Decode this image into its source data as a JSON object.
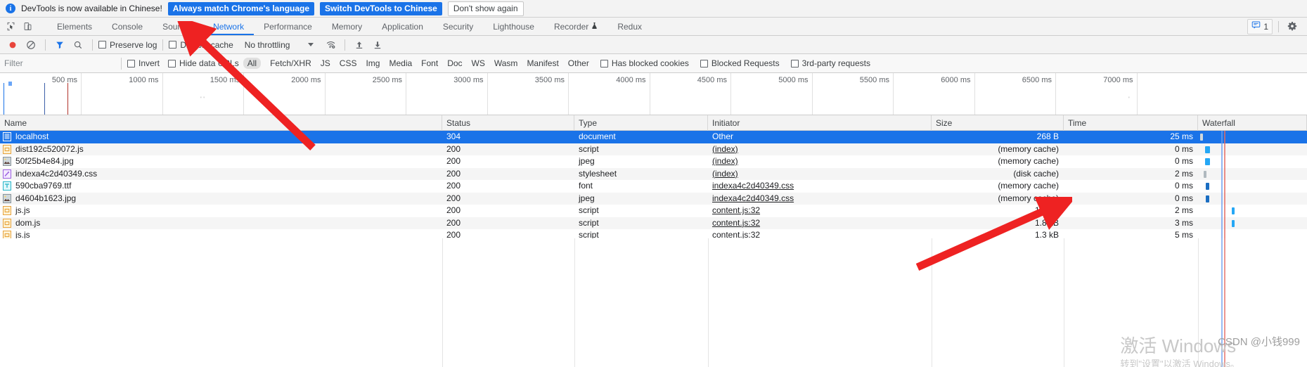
{
  "infobar": {
    "icon": "info-icon",
    "message": "DevTools is now available in Chinese!",
    "always_match_label": "Always match Chrome's language",
    "switch_label": "Switch DevTools to Chinese",
    "dismiss_label": "Don't show again"
  },
  "tabs": {
    "items": [
      {
        "label": "Elements",
        "active": false
      },
      {
        "label": "Console",
        "active": false
      },
      {
        "label": "Sources",
        "active": false
      },
      {
        "label": "Network",
        "active": true
      },
      {
        "label": "Performance",
        "active": false
      },
      {
        "label": "Memory",
        "active": false
      },
      {
        "label": "Application",
        "active": false
      },
      {
        "label": "Security",
        "active": false
      },
      {
        "label": "Lighthouse",
        "active": false
      },
      {
        "label": "Recorder",
        "active": false
      },
      {
        "label": "Redux",
        "active": false
      }
    ],
    "issues_count": "1",
    "inspect_icon": "inspect-cursor-icon",
    "device_icon": "device-toolbar-icon",
    "settings_icon": "gear-icon",
    "recorder_icon": "flask-icon",
    "issues_icon": "issues-message-icon"
  },
  "toolbar": {
    "record_icon": "record-stop-icon",
    "clear_icon": "clear-no-entry-icon",
    "filter_icon": "funnel-filter-icon",
    "search_icon": "search-magnifier-icon",
    "preserve_log_label": "Preserve log",
    "preserve_log_checked": false,
    "disable_cache_label": "Disable cache",
    "disable_cache_checked": false,
    "throttling_label": "No throttling",
    "wifi_icon": "network-conditions-wifi-icon",
    "import_icon": "import-har-up-arrow-icon",
    "export_icon": "export-har-down-arrow-icon"
  },
  "filterbar": {
    "placeholder": "Filter",
    "value": "",
    "invert_label": "Invert",
    "invert_checked": false,
    "hide_data_urls_label": "Hide data URLs",
    "hide_data_urls_checked": false,
    "types": [
      {
        "label": "All",
        "active": true
      },
      {
        "label": "Fetch/XHR",
        "active": false
      },
      {
        "label": "JS",
        "active": false
      },
      {
        "label": "CSS",
        "active": false
      },
      {
        "label": "Img",
        "active": false
      },
      {
        "label": "Media",
        "active": false
      },
      {
        "label": "Font",
        "active": false
      },
      {
        "label": "Doc",
        "active": false
      },
      {
        "label": "WS",
        "active": false
      },
      {
        "label": "Wasm",
        "active": false
      },
      {
        "label": "Manifest",
        "active": false
      },
      {
        "label": "Other",
        "active": false
      }
    ],
    "has_blocked_cookies_label": "Has blocked cookies",
    "has_blocked_cookies_checked": false,
    "blocked_requests_label": "Blocked Requests",
    "blocked_requests_checked": false,
    "third_party_label": "3rd-party requests",
    "third_party_checked": false
  },
  "overview": {
    "ticks": [
      "500 ms",
      "1000 ms",
      "1500 ms",
      "2000 ms",
      "2500 ms",
      "3000 ms",
      "3500 ms",
      "4000 ms",
      "4500 ms",
      "5000 ms",
      "5500 ms",
      "6000 ms",
      "6500 ms",
      "7000 ms"
    ]
  },
  "table": {
    "columns": [
      "Name",
      "Status",
      "Type",
      "Initiator",
      "Size",
      "Time",
      "Waterfall"
    ],
    "rows": [
      {
        "name": "localhost",
        "icon": "document-page-icon",
        "status": "304",
        "type": "document",
        "initiator": "Other",
        "initiator_link": false,
        "size": "268 B",
        "time": "25 ms",
        "selected": true
      },
      {
        "name": "dist192c520072.js",
        "icon": "script-file-icon",
        "status": "200",
        "type": "script",
        "initiator": "(index)",
        "initiator_link": true,
        "size": "(memory cache)",
        "time": "0 ms",
        "selected": false
      },
      {
        "name": "50f25b4e84.jpg",
        "icon": "image-file-icon",
        "status": "200",
        "type": "jpeg",
        "initiator": "(index)",
        "initiator_link": true,
        "size": "(memory cache)",
        "time": "0 ms",
        "selected": false
      },
      {
        "name": "indexa4c2d40349.css",
        "icon": "stylesheet-file-icon",
        "status": "200",
        "type": "stylesheet",
        "initiator": "(index)",
        "initiator_link": true,
        "size": "(disk cache)",
        "time": "2 ms",
        "selected": false
      },
      {
        "name": "590cba9769.ttf",
        "icon": "font-file-icon",
        "status": "200",
        "type": "font",
        "initiator": "indexa4c2d40349.css",
        "initiator_link": true,
        "size": "(memory cache)",
        "time": "0 ms",
        "selected": false
      },
      {
        "name": "d4604b1623.jpg",
        "icon": "image-file-icon",
        "status": "200",
        "type": "jpeg",
        "initiator": "indexa4c2d40349.css",
        "initiator_link": true,
        "size": "(memory cache)",
        "time": "0 ms",
        "selected": false
      },
      {
        "name": "js.js",
        "icon": "script-file-icon",
        "status": "200",
        "type": "script",
        "initiator": "content.js:32",
        "initiator_link": true,
        "size": "1.3 kB",
        "time": "2 ms",
        "selected": false
      },
      {
        "name": "dom.js",
        "icon": "script-file-icon",
        "status": "200",
        "type": "script",
        "initiator": "content.js:32",
        "initiator_link": true,
        "size": "1.8 kB",
        "time": "3 ms",
        "selected": false
      },
      {
        "name": "js.js",
        "icon": "script-file-icon",
        "status": "200",
        "type": "script",
        "initiator": "content.js:32",
        "initiator_link": true,
        "size": "1.3 kB",
        "time": "5 ms",
        "selected": false
      }
    ]
  },
  "watermark": {
    "activate_windows_title": "激活 Windows",
    "activate_windows_sub": "转到\"设置\"以激活 Windows。",
    "csdn": "CSDN @小钱999"
  },
  "colors": {
    "accent": "#1a73e8",
    "selected_row": "#1a73e8",
    "record_red": "#e8453c",
    "waterfall_blue": "#25a7f5",
    "waterfall_dark_blue": "#1b6ec2",
    "red_arrow": "#ee2222"
  }
}
